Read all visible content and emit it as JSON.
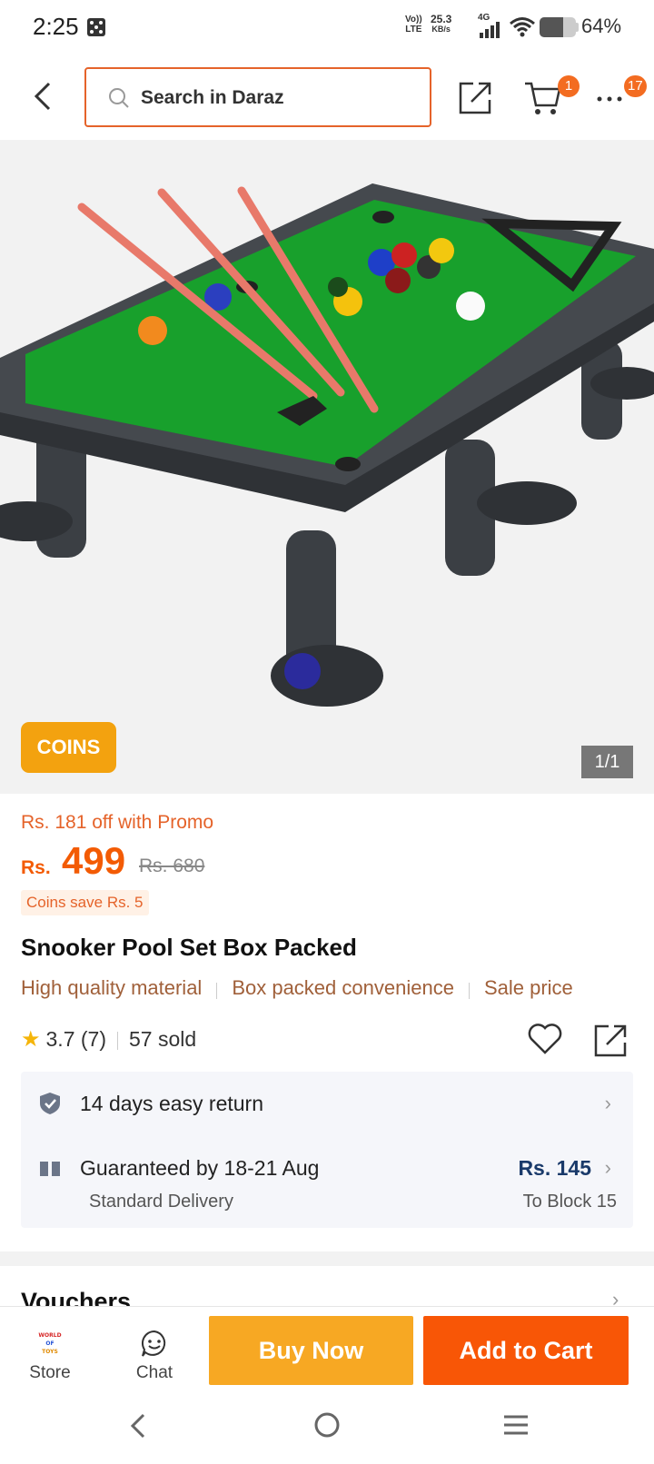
{
  "status_bar": {
    "time": "2:25",
    "net_type_top": "Vo))",
    "net_type_bottom": "LTE",
    "speed_value": "25.3",
    "speed_unit": "KB/s",
    "signal_label": "4G",
    "battery_percent": "64%",
    "battery_level": 0.64
  },
  "header": {
    "search_placeholder": "Search in Daraz",
    "cart_badge": "1",
    "more_badge": "17"
  },
  "gallery": {
    "coins_label": "COINS",
    "pager": "1/1"
  },
  "product": {
    "promo_text": "Rs. 181 off with Promo",
    "currency": "Rs.",
    "price": "499",
    "original_price": "Rs. 680",
    "coins_save": "Coins save Rs. 5",
    "title": "Snooker Pool Set Box Packed",
    "tags": [
      "High quality material",
      "Box packed convenience",
      "Sale price"
    ],
    "rating": "3.7",
    "rating_count": "(7)",
    "sold": "57 sold"
  },
  "service": {
    "return_text": "14 days easy return",
    "delivery_text": "Guaranteed by 18-21 Aug",
    "delivery_type": "Standard Delivery",
    "delivery_fee": "Rs. 145",
    "delivery_dest": "To Block 15"
  },
  "vouchers_title": "Vouchers",
  "action_bar": {
    "store_label": "Store",
    "chat_label": "Chat",
    "buy_now": "Buy Now",
    "add_to_cart": "Add to Cart",
    "store_logo_text": "WORLD OF TOYS"
  },
  "colors": {
    "accent_orange": "#f85606",
    "buy_now_yellow": "#f7a823",
    "coins_gold": "#f3a20f",
    "price_orange": "#f35b04"
  }
}
